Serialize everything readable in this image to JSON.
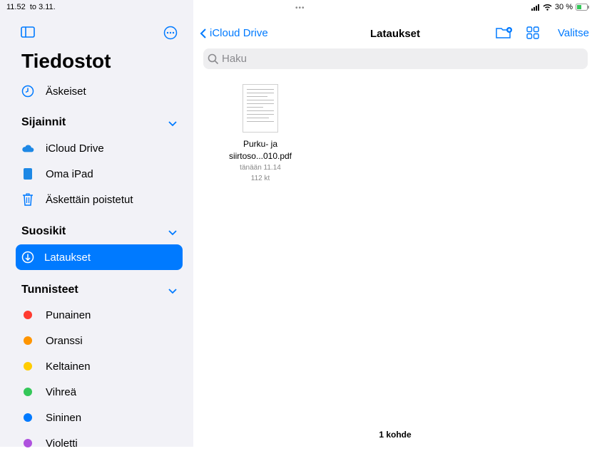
{
  "status": {
    "time": "11.52",
    "date": "to 3.11.",
    "battery": "30 %"
  },
  "sidebar": {
    "title": "Tiedostot",
    "recent": "Äskeiset",
    "locations": {
      "header": "Sijainnit",
      "items": [
        "iCloud Drive",
        "Oma iPad",
        "Äskettäin poistetut"
      ]
    },
    "favorites": {
      "header": "Suosikit",
      "items": [
        "Lataukset"
      ]
    },
    "tags": {
      "header": "Tunnisteet",
      "items": [
        {
          "label": "Punainen",
          "color": "#ff3b30"
        },
        {
          "label": "Oranssi",
          "color": "#ff9500"
        },
        {
          "label": "Keltainen",
          "color": "#ffcc00"
        },
        {
          "label": "Vihreä",
          "color": "#34c759"
        },
        {
          "label": "Sininen",
          "color": "#007aff"
        },
        {
          "label": "Violetti",
          "color": "#af52de"
        }
      ]
    }
  },
  "nav": {
    "back_label": "iCloud Drive",
    "title": "Lataukset",
    "select_label": "Valitse"
  },
  "search": {
    "placeholder": "Haku"
  },
  "files": [
    {
      "name_line1": "Purku- ja",
      "name_line2": "siirtoso...010.pdf",
      "date": "tänään 11.14",
      "size": "112 kt"
    }
  ],
  "footer": {
    "count": "1 kohde"
  },
  "colors": {
    "accent": "#007aff",
    "sidebar_bg": "#f2f2f7"
  }
}
